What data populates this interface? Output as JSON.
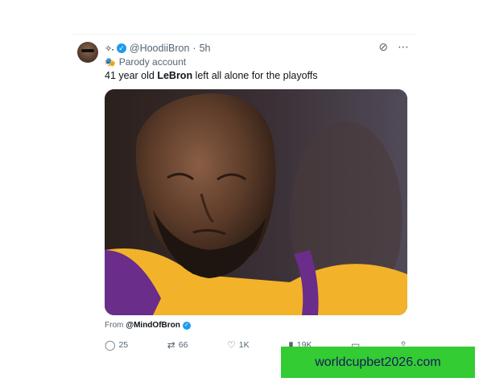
{
  "tweet": {
    "display_name": "✧˖",
    "handle": "@HoodiiBron",
    "separator": "·",
    "time": "5h",
    "parody_label": "Parody account",
    "text_before": "41 year old ",
    "text_bold": "LeBron",
    "text_after": " left all alone for the playoffs",
    "from_prefix": "From",
    "from_handle": "@MindOfBron"
  },
  "actions": {
    "replies": "25",
    "reposts": "66",
    "likes": "1K",
    "views": "19K"
  },
  "promo": {
    "text": "worldcupbet2026.com"
  },
  "colors": {
    "accent": "#1d9bf0",
    "muted": "#536471",
    "promo_bg": "#33cc33",
    "promo_text": "#1a1a5e"
  }
}
